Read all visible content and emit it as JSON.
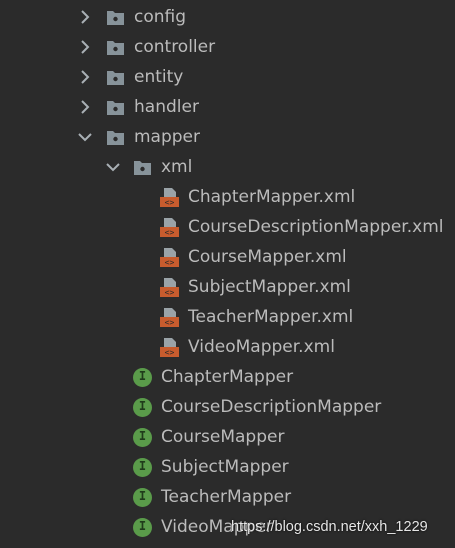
{
  "tree": {
    "folders": [
      {
        "label": "config",
        "expanded": false
      },
      {
        "label": "controller",
        "expanded": false
      },
      {
        "label": "entity",
        "expanded": false
      },
      {
        "label": "handler",
        "expanded": false
      },
      {
        "label": "mapper",
        "expanded": true
      }
    ],
    "subfolder": {
      "label": "xml",
      "expanded": true
    },
    "xml_files": [
      "ChapterMapper.xml",
      "CourseDescriptionMapper.xml",
      "CourseMapper.xml",
      "SubjectMapper.xml",
      "TeacherMapper.xml",
      "VideoMapper.xml"
    ],
    "interfaces": [
      "ChapterMapper",
      "CourseDescriptionMapper",
      "CourseMapper",
      "SubjectMapper",
      "TeacherMapper",
      "VideoMapper"
    ],
    "interface_badge": "I"
  },
  "watermark": "https://blog.csdn.net/xxh_1229",
  "colors": {
    "background": "#2b2b2b",
    "text": "#bbbbbb",
    "folder": "#87939a",
    "xml_icon": "#c75c2e",
    "interface_icon": "#5a9b4a",
    "arrow": "#a9b0b5"
  }
}
